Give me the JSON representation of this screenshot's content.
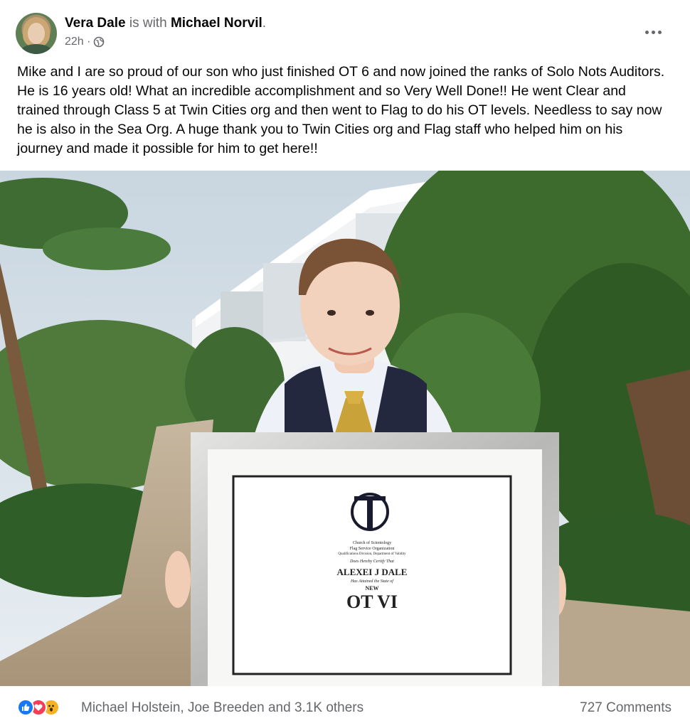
{
  "post": {
    "author": "Vera Dale",
    "with_text": "is with",
    "tagged": "Michael Norvil",
    "period": ".",
    "time": "22h ·",
    "privacy_icon": "globe-icon",
    "more_icon": "more-icon",
    "body": "Mike and I are so proud of our son who just finished OT 6 and now joined the ranks of Solo Nots Auditors. He is 16 years old! What an incredible accomplishment and so Very Well Done!! He went Clear and trained through Class 5 at Twin Cities org and then went to Flag to do his OT levels. Needless to say now he is also in the Sea Org. A huge thank you to Twin Cities org and Flag staff who helped him on his journey and made it possible for him to get here!!"
  },
  "photo": {
    "certificate": {
      "org_line1": "Church of Scientology",
      "org_line2": "Flag Service Organization",
      "org_line3": "Qualifications Division, Department of Validity",
      "certify": "Does Hereby Certify That",
      "name": "ALEXEI J DALE",
      "attained": "Has Attained the State of",
      "state_small": "NEW",
      "state_large": "OT VI"
    }
  },
  "footer": {
    "reaction_icons": [
      "like-icon",
      "love-icon",
      "wow-icon"
    ],
    "reaction_names": "Michael Holstein, Joe Breeden and 3.1K others",
    "comments": "727 Comments"
  },
  "colors": {
    "text": "#050505",
    "secondary": "#65676b",
    "like": "#1877f2",
    "love": "#f33e58",
    "wow": "#f7b125"
  }
}
